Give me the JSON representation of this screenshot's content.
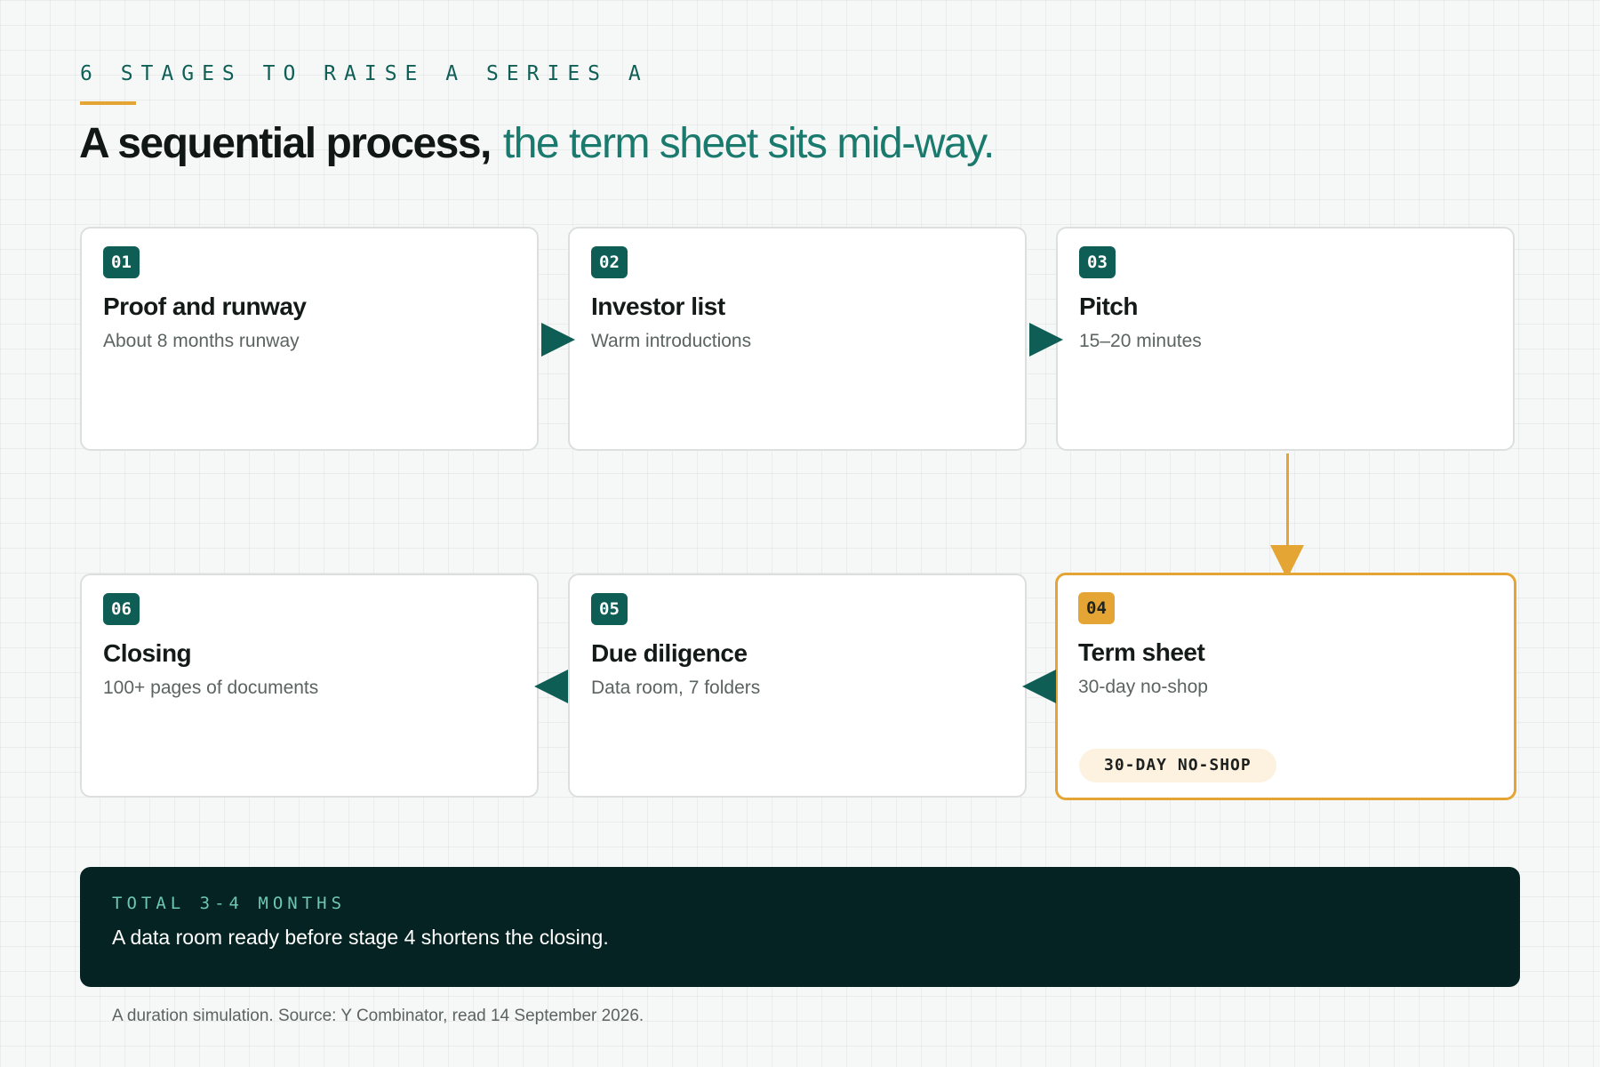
{
  "eyebrow": "6 STAGES TO RAISE A SERIES A",
  "headline": {
    "strong": "A sequential process,",
    "accent": "the term sheet sits mid-way."
  },
  "stages": [
    {
      "num": "01",
      "title": "Proof and runway",
      "subtitle": "About 8 months runway"
    },
    {
      "num": "02",
      "title": "Investor list",
      "subtitle": "Warm introductions"
    },
    {
      "num": "03",
      "title": "Pitch",
      "subtitle": "15–20 minutes"
    },
    {
      "num": "04",
      "title": "Term sheet",
      "subtitle": "30-day no-shop",
      "badge": "30-DAY NO-SHOP"
    },
    {
      "num": "05",
      "title": "Due diligence",
      "subtitle": "Data room, 7 folders"
    },
    {
      "num": "06",
      "title": "Closing",
      "subtitle": "100+ pages of documents"
    }
  ],
  "footer": {
    "eyebrow": "TOTAL 3-4 MONTHS",
    "text": "A data room ready before stage 4 shortens the closing."
  },
  "source": "A duration simulation. Source: Y Combinator, read 14 September 2026.",
  "colors": {
    "primary": "#0e5e55",
    "accent_text": "#1a7a6e",
    "highlight": "#e5a535",
    "dark_panel": "#052322",
    "background": "#f6f8f7"
  }
}
